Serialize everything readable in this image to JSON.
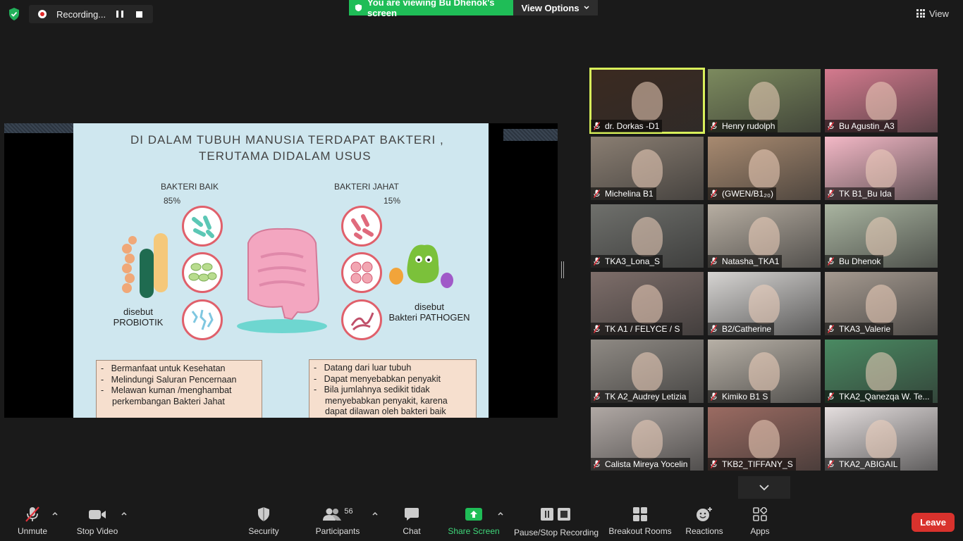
{
  "top": {
    "recording_label": "Recording...",
    "viewing_label": "You are viewing Bu Dhenok's screen",
    "view_options_label": "View Options",
    "view_label": "View"
  },
  "slide": {
    "title_line1": "DI DALAM TUBUH MANUSIA TERDAPAT BAKTERI ,",
    "title_line2": "TERUTAMA DIDALAM USUS",
    "good_label": "BAKTERI BAIK",
    "good_pct": "85%",
    "bad_label": "BAKTERI JAHAT",
    "bad_pct": "15%",
    "probiotic_line1": "disebut",
    "probiotic_line2": "PROBIOTIK",
    "pathogen_line1": "disebut",
    "pathogen_line2": "Bakteri PATHOGEN",
    "good_points": [
      "Bermanfaat untuk Kesehatan",
      "Melindungi Saluran Pencernaan",
      "Melawan kuman /menghambat perkembangan Bakteri Jahat"
    ],
    "bad_points": [
      "Datang dari luar tubuh",
      "Dapat menyebabkan penyakit",
      "Bila jumlahnya sedikit tidak menyebabkan penyakit, karena dapat dilawan oleh bakteri baik"
    ]
  },
  "participants": [
    {
      "name": "dr. Dorkas -D1",
      "bg": "#3b2a20",
      "active": true
    },
    {
      "name": "Henry rudolph",
      "bg": "#7c8a5e"
    },
    {
      "name": "Bu Agustin_A3",
      "bg": "#d47a8e"
    },
    {
      "name": "Michelina B1",
      "bg": "#8a7e72"
    },
    {
      "name": "(GWEN/B1₂₀)",
      "bg": "#a88a70"
    },
    {
      "name": "TK B1_Bu Ida",
      "bg": "#f3b8c6"
    },
    {
      "name": "TKA3_Lona_S",
      "bg": "#6f706c"
    },
    {
      "name": "Natasha_TKA1",
      "bg": "#b7aea2"
    },
    {
      "name": "Bu Dhenok",
      "bg": "#a9b4a0"
    },
    {
      "name": "TK A1 / FELYCE / S",
      "bg": "#7e6e6a"
    },
    {
      "name": "B2/Catherine",
      "bg": "#d6d4d2"
    },
    {
      "name": "TKA3_Valerie",
      "bg": "#a59a90"
    },
    {
      "name": "TK A2_Audrey Letizia",
      "bg": "#8f8a84"
    },
    {
      "name": "Kimiko B1 S",
      "bg": "#b7b0a6"
    },
    {
      "name": "TKA2_Qanezqa W. Te...",
      "bg": "#4a8a62"
    },
    {
      "name": "Calista Mireya Yocelin",
      "bg": "#b0a8a4"
    },
    {
      "name": "TKB2_TIFFANY_S",
      "bg": "#9b6b62"
    },
    {
      "name": "TKA2_ABIGAIL",
      "bg": "#e4dede"
    }
  ],
  "toolbar": {
    "unmute": "Unmute",
    "stop_video": "Stop Video",
    "security": "Security",
    "participants": "Participants",
    "participants_count": "56",
    "chat": "Chat",
    "share_screen": "Share Screen",
    "pause_stop_recording": "Pause/Stop Recording",
    "breakout_rooms": "Breakout Rooms",
    "reactions": "Reactions",
    "apps": "Apps",
    "leave": "Leave"
  },
  "colors": {
    "share_green": "#1fbd57",
    "leave_red": "#d9322d",
    "active_speaker": "#d8ef5a",
    "muted_red": "#e0303a"
  }
}
